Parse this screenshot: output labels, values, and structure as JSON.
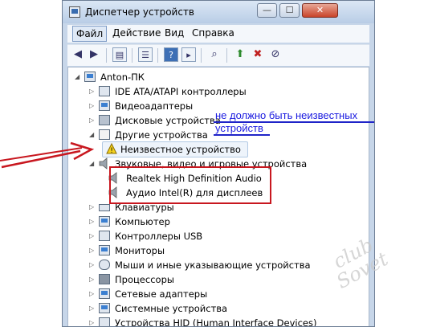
{
  "window": {
    "title": "Диспетчер устройств",
    "min_label": "—",
    "max_label": "☐",
    "close_label": "✕"
  },
  "menu": [
    "Файл",
    "Действие",
    "Вид",
    "Справка"
  ],
  "tree": {
    "root": "Anton-ПК",
    "items": [
      "IDE ATA/ATAPI контроллеры",
      "Видеоадаптеры",
      "Дисковые устройства",
      "Другие устройства",
      "Неизвестное устройство",
      "Звуковые, видео и игровые устройства",
      "Realtek High Definition Audio",
      "Аудио Intel(R) для дисплеев",
      "Клавиатуры",
      "Компьютер",
      "Контроллеры USB",
      "Мониторы",
      "Мыши и иные указывающие устройства",
      "Процессоры",
      "Сетевые адаптеры",
      "Системные устройства",
      "Устройства HID (Human Interface Devices)"
    ]
  },
  "annotation": {
    "line1": "не должно быть неизвестных",
    "line2": "устройств"
  },
  "watermark": {
    "line1": "club",
    "line2": "Sovet"
  },
  "colors": {
    "annotation_blue": "#1f24c8",
    "annotation_red": "#c8171f"
  }
}
